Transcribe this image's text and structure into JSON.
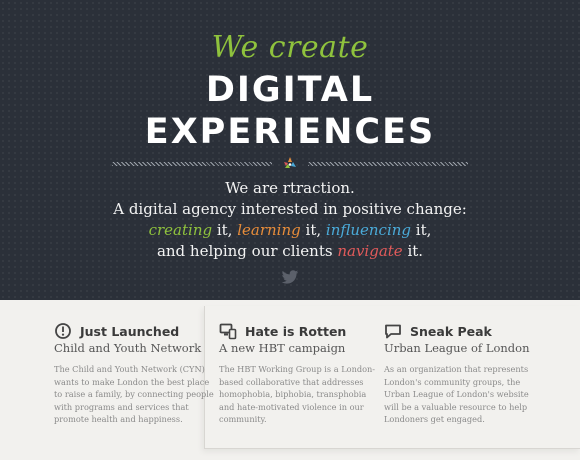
{
  "hero": {
    "tagline": "We create",
    "headline_line1": "DIGITAL",
    "headline_line2": "EXPERIENCES",
    "intro_line1": "We are rtraction.",
    "intro_line2": "A digital agency interested in positive change:",
    "line3": {
      "w1": "creating",
      "t1": " it, ",
      "w2": "learning",
      "t2": " it, ",
      "w3": "influencing",
      "t3": " it,"
    },
    "line4": {
      "pre": "and helping our clients ",
      "word": "navigate",
      "post": " it."
    },
    "icons": [
      "rtraction-logo-icon",
      "twitter-bird-icon"
    ]
  },
  "colors": {
    "hero_bg": "#2b3039",
    "green": "#8fc23d",
    "orange": "#e68c3a",
    "blue": "#4aaad8",
    "red": "#e05a5a",
    "lower_bg": "#f2f1ee"
  },
  "columns": [
    {
      "icon": "clock-alert-icon",
      "title": "Just Launched",
      "subtitle": "Child and Youth Network",
      "body": "The Child and Youth Network (CYN) wants to make London the best place to raise a family, by connecting people with programs and services that promote health and happiness."
    },
    {
      "icon": "devices-icon",
      "title": "Hate is Rotten",
      "subtitle": "A new HBT campaign",
      "body": "The HBT Working Group is a London-based collaborative that addresses homophobia, biphobia, transphobia and hate-motivated violence in our community."
    },
    {
      "icon": "speech-bubble-icon",
      "title": "Sneak Peak",
      "subtitle": "Urban League of London",
      "body": "As an organization that represents London's community groups, the Urban League of London's website will be a valuable resource to help Londoners get engaged."
    }
  ]
}
